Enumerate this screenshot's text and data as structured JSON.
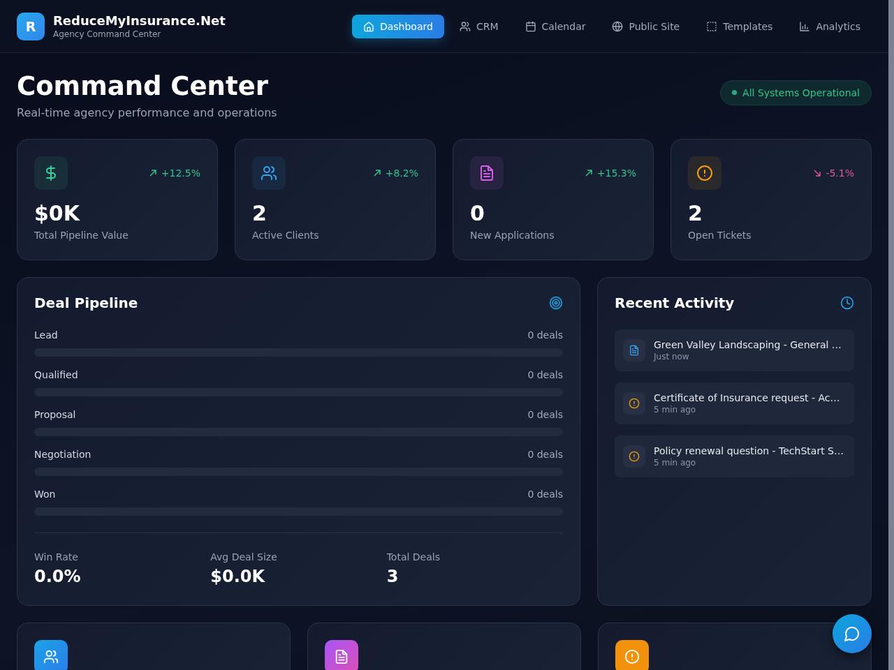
{
  "brand": {
    "logo_letter": "R",
    "name": "ReduceMyInsurance.Net",
    "tagline": "Agency Command Center"
  },
  "nav": [
    {
      "label": "Dashboard",
      "selected": true
    },
    {
      "label": "CRM",
      "selected": false
    },
    {
      "label": "Calendar",
      "selected": false
    },
    {
      "label": "Public Site",
      "selected": false
    },
    {
      "label": "Templates",
      "selected": false
    },
    {
      "label": "Analytics",
      "selected": false
    }
  ],
  "page": {
    "title": "Command Center",
    "subtitle": "Real-time agency performance and operations",
    "status": "All Systems Operational"
  },
  "stats": [
    {
      "value": "$0K",
      "label": "Total Pipeline Value",
      "change": "+12.5%",
      "negative": false,
      "color": "#34d399"
    },
    {
      "value": "2",
      "label": "Active Clients",
      "change": "+8.2%",
      "negative": false,
      "color": "#38a4f0"
    },
    {
      "value": "0",
      "label": "New Applications",
      "change": "+15.3%",
      "negative": false,
      "color": "#d35ee8"
    },
    {
      "value": "2",
      "label": "Open Tickets",
      "change": "-5.1%",
      "negative": true,
      "color": "#f59e0b"
    }
  ],
  "pipeline": {
    "title": "Deal Pipeline",
    "stages": [
      {
        "name": "Lead",
        "count": "0 deals",
        "level": 0
      },
      {
        "name": "Qualified",
        "count": "0 deals",
        "level": 0
      },
      {
        "name": "Proposal",
        "count": "0 deals",
        "level": 0
      },
      {
        "name": "Negotiation",
        "count": "0 deals",
        "level": 0
      },
      {
        "name": "Won",
        "count": "0 deals",
        "level": 0
      }
    ],
    "metrics": [
      {
        "label": "Win Rate",
        "value": "0.0%"
      },
      {
        "label": "Avg Deal Size",
        "value": "$0.0K"
      },
      {
        "label": "Total Deals",
        "value": "3"
      }
    ]
  },
  "activity": {
    "title": "Recent Activity",
    "items": [
      {
        "kind": "document",
        "text": "Green Valley Landscaping - General …",
        "time": "Just now"
      },
      {
        "kind": "alert",
        "text": "Certificate of Insurance request - Ac…",
        "time": "5 min ago"
      },
      {
        "kind": "alert",
        "text": "Policy renewal question - TechStart S…",
        "time": "5 min ago"
      }
    ]
  },
  "quick_cards": [
    {
      "kind": "users"
    },
    {
      "kind": "document"
    },
    {
      "kind": "alert"
    }
  ]
}
